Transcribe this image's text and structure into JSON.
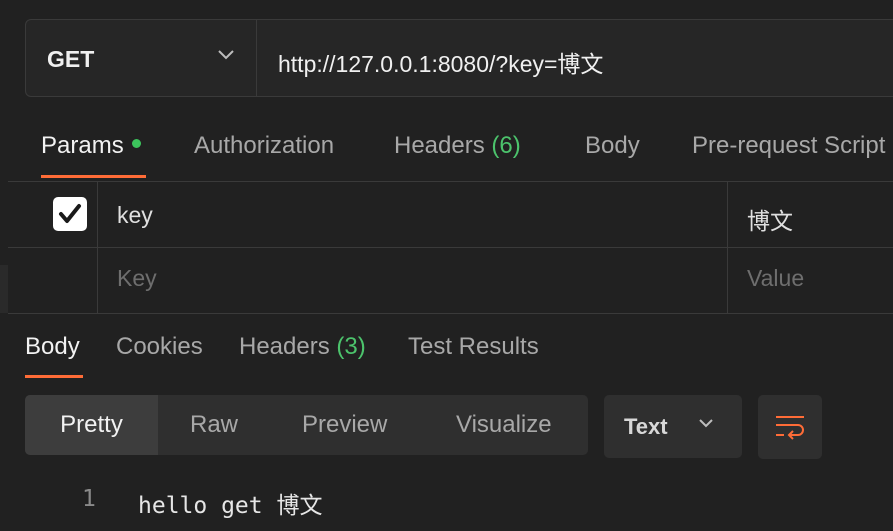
{
  "request": {
    "method": "GET",
    "url": "http://127.0.0.1:8080/?key=博文"
  },
  "request_tabs": {
    "params": "Params",
    "authorization": "Authorization",
    "headers": "Headers",
    "headers_count": "(6)",
    "body": "Body",
    "prerequest": "Pre-request Script"
  },
  "params_table": {
    "rows": [
      {
        "checked": true,
        "key": "key",
        "value": "博文"
      }
    ],
    "new_row": {
      "key_placeholder": "Key",
      "value_placeholder": "Value"
    }
  },
  "response_tabs": {
    "body": "Body",
    "cookies": "Cookies",
    "headers": "Headers",
    "headers_count": "(3)",
    "test_results": "Test Results"
  },
  "view_modes": [
    "Pretty",
    "Raw",
    "Preview",
    "Visualize"
  ],
  "format": {
    "selected": "Text"
  },
  "response_body": {
    "lines": [
      {
        "number": "1",
        "text": "hello get 博文"
      }
    ]
  },
  "colors": {
    "accent": "#ff6c37",
    "count_green": "#4cc36c",
    "background": "#212121"
  },
  "icons": [
    "chevron-down-icon",
    "checkmark-icon",
    "wrap-lines-icon",
    "status-dot-icon"
  ]
}
